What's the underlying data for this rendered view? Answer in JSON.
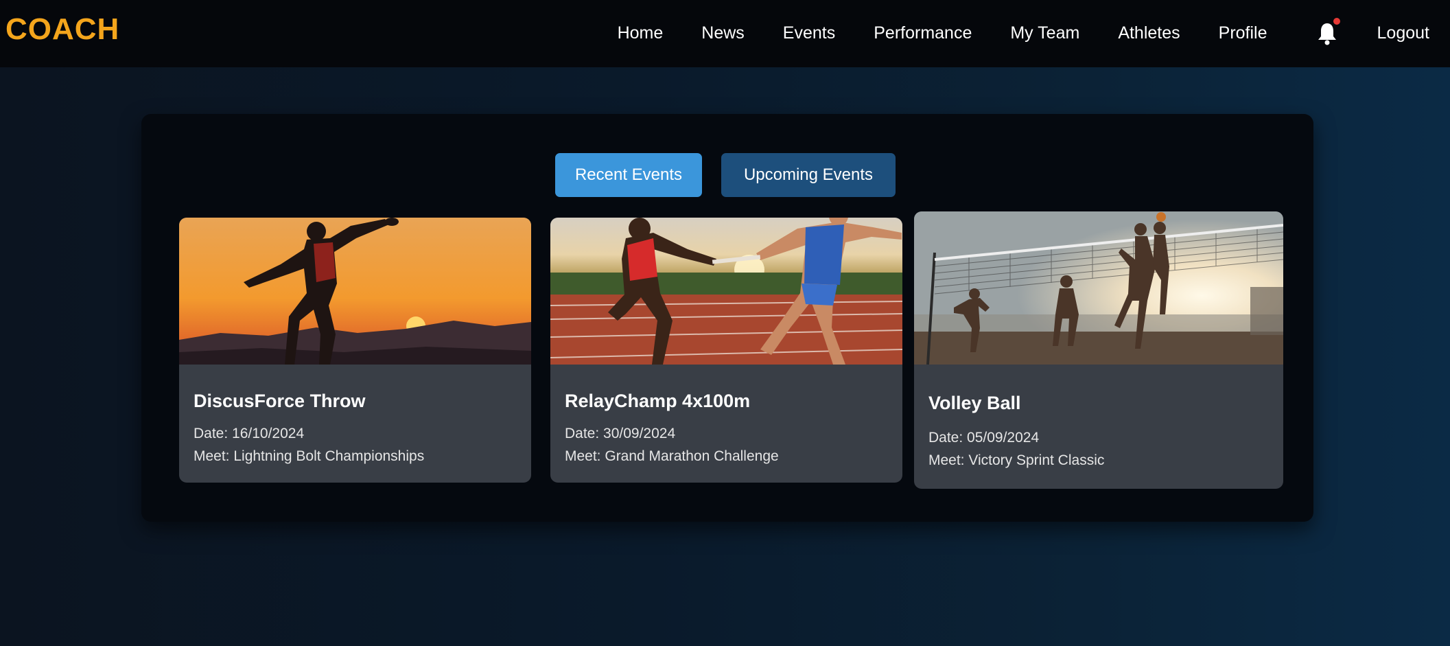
{
  "brand": "COACH",
  "nav": {
    "items": [
      "Home",
      "News",
      "Events",
      "Performance",
      "My Team",
      "Athletes",
      "Profile"
    ],
    "logout": "Logout"
  },
  "tabs": {
    "recent": "Recent Events",
    "upcoming": "Upcoming Events"
  },
  "cards": [
    {
      "title": "DiscusForce Throw",
      "date": "Date: 16/10/2024",
      "meet": "Meet: Lightning Bolt Championships"
    },
    {
      "title": "RelayChamp 4x100m",
      "date": "Date: 30/09/2024",
      "meet": "Meet: Grand Marathon Challenge"
    },
    {
      "title": "Volley Ball",
      "date": "Date: 05/09/2024",
      "meet": "Meet: Victory Sprint Classic"
    }
  ],
  "colors": {
    "brand": "#f4a51c",
    "tab_active": "#3b96db",
    "tab_inactive": "#1d4f7c",
    "card_bg": "#393e46",
    "notification_dot": "#e53935"
  },
  "icons": [
    "bell-icon"
  ]
}
